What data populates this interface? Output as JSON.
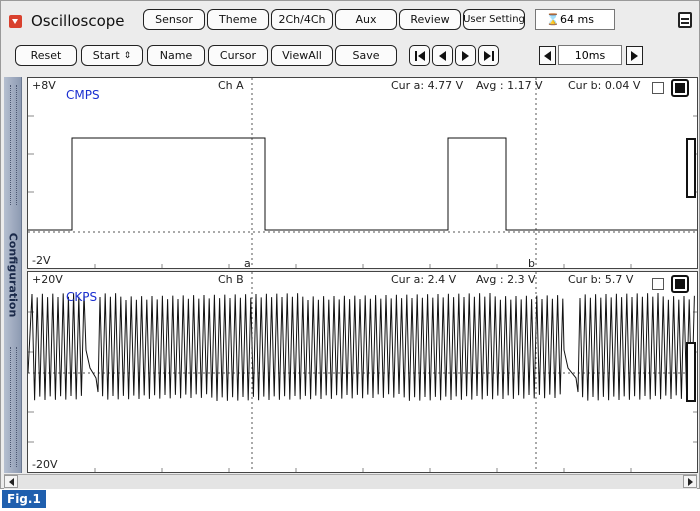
{
  "header": {
    "title": "Oscilloscope",
    "toolbar1": [
      "Sensor",
      "Theme",
      "2Ch/4Ch",
      "Aux",
      "Review",
      "User Setting"
    ],
    "capture_time": "64 ms"
  },
  "toolbar2": {
    "reset": "Reset",
    "start": "Start",
    "name": "Name",
    "cursor": "Cursor",
    "viewall": "ViewAll",
    "save": "Save",
    "time_div": "10ms"
  },
  "sidebar": {
    "label": "Configuration"
  },
  "channels": [
    {
      "id": "A",
      "label": "Ch A",
      "signal": "CMPS",
      "vmax_label": "+8V",
      "vmin_label": "-2V",
      "cur_a": "Cur a: 4.77 V",
      "avg": "Avg  : 1.17 V",
      "cur_b": "Cur b: 0.04 V",
      "cursor_a": "a",
      "cursor_b": "b"
    },
    {
      "id": "B",
      "label": "Ch B",
      "signal": "CKPS",
      "vmax_label": "+20V",
      "vmin_label": "-20V",
      "cur_a": "Cur a: 2.4 V",
      "avg": "Avg  : 2.3 V",
      "cur_b": "Cur b: 5.7 V"
    }
  ],
  "figure_label": "Fig.1",
  "colors": {
    "accent": "#1f5fae",
    "signal_label": "#1a2fd0",
    "logo": "#d9412e"
  }
}
